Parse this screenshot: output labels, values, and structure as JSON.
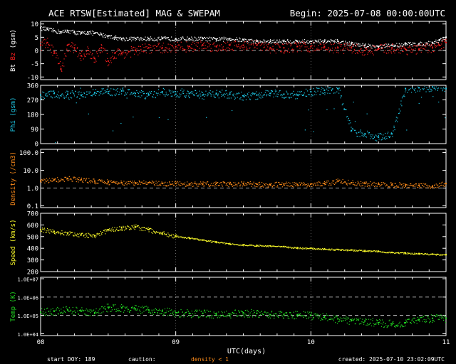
{
  "header": {
    "title": "ACE RTSW[Estimated] MAG & SWEPAM",
    "begin": "Begin: 2025-07-08 00:00:00UTC"
  },
  "footer": {
    "start_doy": "start DOY: 189",
    "caution": "caution:",
    "density_note": "density < 1",
    "created": "created: 2025-07-10 23:02:09UTC"
  },
  "colors": {
    "bt": "#ffffff",
    "bz": "#ff2020",
    "phi": "#1ec8e6",
    "density": "#ff8c1a",
    "speed": "#ffff2a",
    "temp": "#22dd22",
    "axis": "#ffffff"
  },
  "chart_data": [
    {
      "type": "scatter",
      "panel": "mag",
      "ylabel_parts": [
        "Bt",
        "Bz",
        "(gsm)"
      ],
      "ylim": [
        -11,
        11
      ],
      "yticks": [
        "10",
        "5",
        "0",
        "-5",
        "-10"
      ],
      "ytick_values": [
        10,
        5,
        0,
        -5,
        -10
      ],
      "reference_lines": [
        0
      ],
      "x_days": [
        0,
        3
      ],
      "series": [
        {
          "key": "bt",
          "x": [
            0,
            0.05,
            0.1,
            0.15,
            0.2,
            0.25,
            0.3,
            0.35,
            0.4,
            0.45,
            0.5,
            0.55,
            0.6,
            0.7,
            0.8,
            0.9,
            1.0,
            1.1,
            1.2,
            1.3,
            1.4,
            1.5,
            1.6,
            1.7,
            1.8,
            1.9,
            2.0,
            2.1,
            2.2,
            2.3,
            2.4,
            2.5,
            2.6,
            2.7,
            2.8,
            2.9,
            2.95,
            3.0
          ],
          "y": [
            8.5,
            8,
            7.5,
            7,
            7.5,
            7,
            6.5,
            7,
            6.5,
            6,
            5.5,
            5,
            4.5,
            4.5,
            4.5,
            4.5,
            4.5,
            4.5,
            4.5,
            4.3,
            4.5,
            4,
            3.5,
            3.5,
            3.5,
            3.5,
            3.5,
            3.5,
            3.5,
            2.5,
            2,
            1.5,
            2,
            2.5,
            2.5,
            3,
            4,
            5
          ]
        },
        {
          "key": "bz",
          "x": [
            0,
            0.05,
            0.1,
            0.15,
            0.2,
            0.25,
            0.3,
            0.35,
            0.4,
            0.45,
            0.5,
            0.55,
            0.6,
            0.7,
            0.8,
            0.9,
            1.0,
            1.1,
            1.2,
            1.3,
            1.4,
            1.5,
            1.6,
            1.7,
            1.8,
            1.9,
            2.0,
            2.1,
            2.2,
            2.3,
            2.4,
            2.5,
            2.6,
            2.7,
            2.8,
            2.9,
            2.95,
            3.0
          ],
          "y": [
            2,
            3,
            -1,
            -7,
            2,
            1,
            -2,
            0,
            -3,
            1,
            -4,
            -1,
            -1,
            0,
            1,
            1,
            1.5,
            1.5,
            2,
            1.5,
            2,
            2,
            2,
            1,
            1,
            1.5,
            1.5,
            1.5,
            1,
            1,
            0,
            0.5,
            1,
            0.5,
            0.5,
            1,
            2,
            3
          ]
        }
      ]
    },
    {
      "type": "scatter",
      "panel": "phi",
      "ylabel": "Phi (gsm)",
      "ylim": [
        0,
        360
      ],
      "yticks": [
        "360",
        "270",
        "180",
        "90",
        "0"
      ],
      "ytick_values": [
        360,
        270,
        180,
        90,
        0
      ],
      "x_days": [
        0,
        3
      ],
      "series": [
        {
          "key": "phi",
          "x": [
            0,
            0.1,
            0.2,
            0.3,
            0.4,
            0.5,
            0.6,
            0.7,
            0.8,
            0.9,
            1.0,
            1.1,
            1.2,
            1.3,
            1.4,
            1.5,
            1.6,
            1.7,
            1.8,
            1.9,
            2.0,
            2.1,
            2.2,
            2.3,
            2.4,
            2.5,
            2.6,
            2.7,
            2.8,
            2.9,
            3.0
          ],
          "y": [
            300,
            310,
            305,
            300,
            315,
            320,
            325,
            310,
            300,
            320,
            305,
            310,
            300,
            310,
            305,
            295,
            300,
            310,
            305,
            300,
            320,
            330,
            340,
            80,
            60,
            40,
            60,
            340,
            345,
            350,
            340
          ]
        }
      ]
    },
    {
      "type": "scatter",
      "panel": "density",
      "ylabel": "Density (/cm3)",
      "yscale": "log",
      "ylim": [
        0.08,
        150
      ],
      "yticks": [
        "100.0",
        "10.0",
        "1.0",
        "0.1"
      ],
      "ytick_values": [
        100,
        10,
        1,
        0.1
      ],
      "reference_lines": [
        1
      ],
      "x_days": [
        0,
        3
      ],
      "series": [
        {
          "key": "density",
          "x": [
            0,
            0.1,
            0.2,
            0.3,
            0.4,
            0.5,
            0.6,
            0.7,
            0.8,
            0.9,
            1.0,
            1.1,
            1.2,
            1.3,
            1.4,
            1.5,
            1.6,
            1.7,
            1.8,
            1.9,
            2.0,
            2.1,
            2.2,
            2.3,
            2.4,
            2.5,
            2.6,
            2.7,
            2.8,
            2.9,
            3.0
          ],
          "y": [
            2.5,
            3,
            3.5,
            3,
            2.5,
            2.2,
            2,
            2,
            2,
            1.8,
            1.8,
            1.7,
            1.7,
            1.8,
            1.7,
            1.8,
            1.7,
            1.6,
            1.7,
            1.6,
            1.7,
            1.8,
            2.5,
            2,
            1.8,
            1.7,
            1.6,
            1.5,
            1.4,
            1.3,
            1.8
          ]
        }
      ]
    },
    {
      "type": "scatter",
      "panel": "speed",
      "ylabel": "Speed (km/s)",
      "ylim": [
        200,
        700
      ],
      "yticks": [
        "700",
        "600",
        "500",
        "400",
        "300",
        "200"
      ],
      "ytick_values": [
        700,
        600,
        500,
        400,
        300,
        200
      ],
      "x_days": [
        0,
        3
      ],
      "series": [
        {
          "key": "speed",
          "x": [
            0,
            0.1,
            0.2,
            0.3,
            0.4,
            0.5,
            0.6,
            0.7,
            0.8,
            0.9,
            1.0,
            1.1,
            1.2,
            1.3,
            1.4,
            1.5,
            1.6,
            1.7,
            1.8,
            1.9,
            2.0,
            2.1,
            2.2,
            2.3,
            2.4,
            2.5,
            2.6,
            2.7,
            2.8,
            2.9,
            3.0
          ],
          "y": [
            560,
            545,
            530,
            515,
            510,
            560,
            575,
            585,
            560,
            530,
            505,
            490,
            470,
            455,
            440,
            430,
            425,
            420,
            415,
            405,
            400,
            395,
            390,
            385,
            380,
            375,
            365,
            360,
            355,
            350,
            345
          ]
        }
      ]
    },
    {
      "type": "scatter",
      "panel": "temp",
      "ylabel": "Temp (K)",
      "yscale": "log",
      "ylim": [
        8000,
        12000000
      ],
      "yticks": [
        "1.0E+07",
        "1.0E+06",
        "1.0E+05",
        "1.0E+04"
      ],
      "ytick_values": [
        10000000,
        1000000,
        100000,
        10000
      ],
      "reference_lines": [
        1000000,
        100000
      ],
      "xticks": [
        "08",
        "09",
        "10",
        "11"
      ],
      "xtick_values": [
        0,
        1,
        2,
        3
      ],
      "xlabel": "UTC(days)",
      "x_days": [
        0,
        3
      ],
      "series": [
        {
          "key": "temp",
          "x": [
            0,
            0.1,
            0.2,
            0.3,
            0.4,
            0.5,
            0.6,
            0.7,
            0.8,
            0.9,
            1.0,
            1.1,
            1.2,
            1.3,
            1.4,
            1.5,
            1.6,
            1.7,
            1.8,
            1.9,
            2.0,
            2.1,
            2.2,
            2.3,
            2.4,
            2.5,
            2.6,
            2.7,
            2.8,
            2.9,
            3.0
          ],
          "y": [
            150000,
            170000,
            200000,
            170000,
            140000,
            280000,
            260000,
            230000,
            200000,
            170000,
            140000,
            130000,
            130000,
            120000,
            120000,
            140000,
            130000,
            110000,
            110000,
            110000,
            100000,
            80000,
            65000,
            55000,
            50000,
            40000,
            35000,
            40000,
            60000,
            70000,
            70000
          ]
        }
      ]
    }
  ]
}
